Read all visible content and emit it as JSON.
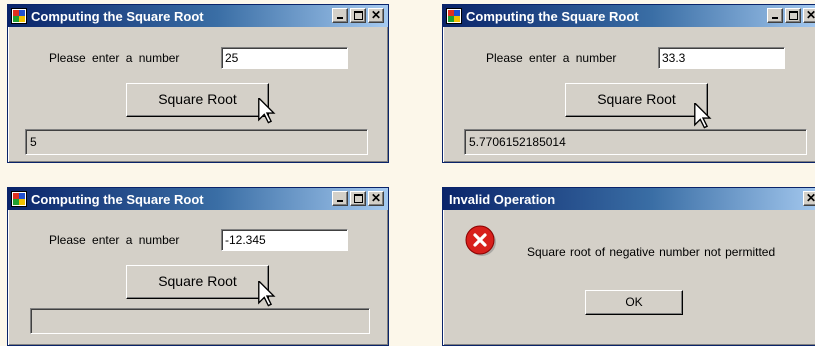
{
  "app_title": "Computing the Square Root",
  "prompt_label": "Please enter a number",
  "button_label": "Square Root",
  "controls": {
    "minimize": "",
    "maximize": "",
    "close": "✕"
  },
  "windows": [
    {
      "input": "25",
      "result": "5"
    },
    {
      "input": "33.3",
      "result": "5.7706152185014"
    },
    {
      "input": "-12.345",
      "result": ""
    }
  ],
  "dialog": {
    "title": "Invalid Operation",
    "message": "Square root of negative number not permitted",
    "ok_label": "OK",
    "icon": "error-icon",
    "close": "✕"
  },
  "colors": {
    "titlebar": "#0a246a",
    "window": "#d4d0c8",
    "error": "#d8201c"
  }
}
